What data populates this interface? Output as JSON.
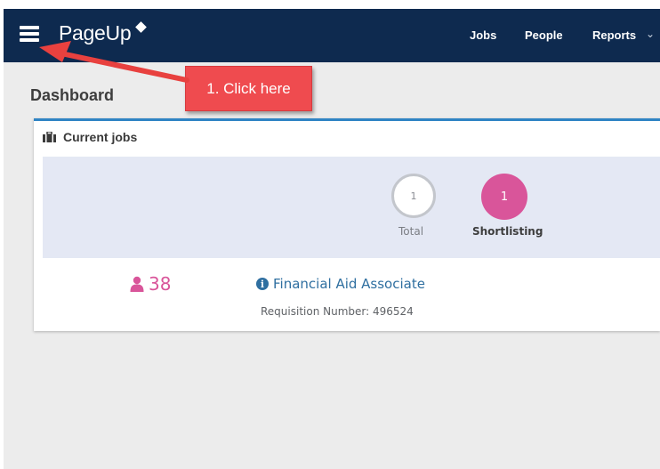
{
  "app": {
    "logo_text": "PageUp"
  },
  "nav": {
    "items": [
      "Jobs",
      "People",
      "Reports"
    ]
  },
  "page": {
    "title": "Dashboard"
  },
  "annotation": {
    "callout_text": "1. Click here",
    "color": "#ef4b4f"
  },
  "current_jobs": {
    "heading": "Current jobs",
    "stats": {
      "total_value": "1",
      "total_label": "Total",
      "shortlisting_value": "1",
      "shortlisting_label": "Shortlisting"
    },
    "job": {
      "applicant_count": "38",
      "title": "Financial Aid Associate",
      "requisition": "Requisition Number: 496524"
    }
  },
  "colors": {
    "topbar": "#0e2a4f",
    "accent_blue": "#2f84c4",
    "pink": "#d9559a",
    "link": "#2f6fa0"
  },
  "icons": [
    "menu-icon",
    "briefcase-icon",
    "person-icon",
    "info-icon",
    "chevron-down-icon"
  ]
}
